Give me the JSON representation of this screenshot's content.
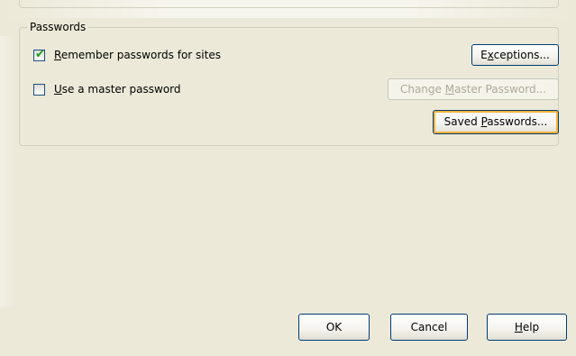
{
  "passwords": {
    "legend": "Passwords",
    "remember": {
      "pre": "",
      "key": "R",
      "post": "emember passwords for sites",
      "checked": true
    },
    "master": {
      "pre": "",
      "key": "U",
      "post": "se a master password",
      "checked": false
    },
    "exceptions": {
      "pre": "E",
      "key": "x",
      "post": "ceptions..."
    },
    "change_master": {
      "pre": "Change ",
      "key": "M",
      "post": "aster Password..."
    },
    "saved": {
      "pre": "Saved ",
      "key": "P",
      "post": "asswords..."
    }
  },
  "dialog": {
    "ok": {
      "pre": "OK",
      "key": "",
      "post": ""
    },
    "cancel": {
      "pre": "Cancel",
      "key": "",
      "post": ""
    },
    "help": {
      "pre": "",
      "key": "H",
      "post": "elp"
    }
  },
  "colors": {
    "background": "#ece9d8",
    "check": "#21a121",
    "button_border": "#003c74",
    "focus": "#f8b33a"
  }
}
